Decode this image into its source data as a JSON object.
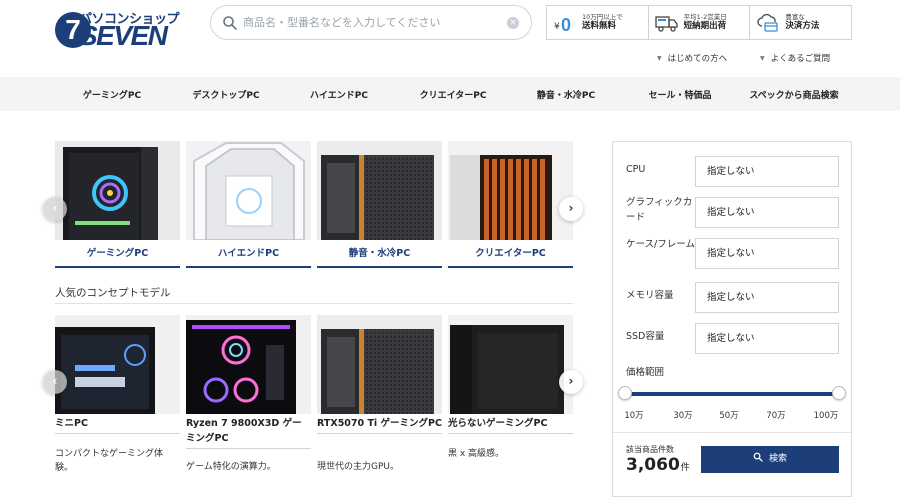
{
  "header": {
    "logo": {
      "kana": "パソコンショップ",
      "brand": "SEVEN",
      "numeral": "7"
    },
    "search": {
      "placeholder": "商品名・型番名などを入力してください",
      "value": ""
    },
    "info": [
      {
        "small": "10万円以上で",
        "main": "送料無料",
        "icon": "zero-yen-icon"
      },
      {
        "small": "平均1-2営業日",
        "main": "短納期出荷",
        "icon": "truck-icon"
      },
      {
        "small": "豊富な",
        "main": "決済方法",
        "icon": "payment-cloud-icon"
      }
    ],
    "sublinks": [
      "はじめての方へ",
      "よくあるご質問"
    ]
  },
  "nav": [
    "ゲーミングPC",
    "デスクトップPC",
    "ハイエンドPC",
    "クリエイターPC",
    "静音・水冷PC",
    "セール・特価品",
    "スペックから商品検索"
  ],
  "categories": [
    {
      "label": "ゲーミングPC"
    },
    {
      "label": "ハイエンドPC"
    },
    {
      "label": "静音・水冷PC"
    },
    {
      "label": "クリエイターPC"
    }
  ],
  "concept": {
    "title": "人気のコンセプトモデル",
    "models": [
      {
        "name": "ミニPC",
        "desc": "コンパクトなゲーミング体験。"
      },
      {
        "name": "Ryzen 7 9800X3D ゲーミングPC",
        "desc": "ゲーム特化の演算力。"
      },
      {
        "name": "RTX5070 Ti ゲーミングPC",
        "desc": "現世代の主力GPU。"
      },
      {
        "name": "光らないゲーミングPC",
        "desc": "黒 x 高級感。"
      }
    ]
  },
  "slider": {
    "prev": "‹",
    "next": "›"
  },
  "filter": {
    "fields": [
      {
        "label": "CPU",
        "value": "指定しない"
      },
      {
        "label": "グラフィックカード",
        "value": "指定しない"
      },
      {
        "label": "ケース/フレーム",
        "value": "指定しない"
      },
      {
        "label": "メモリ容量",
        "value": "指定しない"
      },
      {
        "label": "SSD容量",
        "value": "指定しない"
      }
    ],
    "price_range": {
      "label": "価格範囲",
      "ticks": [
        "10万",
        "30万",
        "50万",
        "70万",
        "100万"
      ],
      "selected_min": "10万",
      "selected_max": "100万"
    },
    "result_label": "該当商品件数",
    "result_count": "3,060",
    "result_unit": "件",
    "search_button": "検索"
  },
  "colors": {
    "brand": "#1c3f7a",
    "nav_bg": "#f4f4f4",
    "accent_wood": "#c8632a"
  }
}
